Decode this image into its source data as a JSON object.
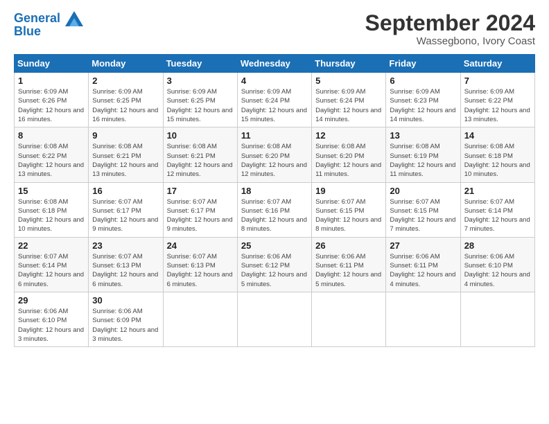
{
  "header": {
    "logo_line1": "General",
    "logo_line2": "Blue",
    "month": "September 2024",
    "location": "Wassegbono, Ivory Coast"
  },
  "weekdays": [
    "Sunday",
    "Monday",
    "Tuesday",
    "Wednesday",
    "Thursday",
    "Friday",
    "Saturday"
  ],
  "weeks": [
    [
      {
        "day": "1",
        "sunrise": "6:09 AM",
        "sunset": "6:26 PM",
        "daylight": "12 hours and 16 minutes."
      },
      {
        "day": "2",
        "sunrise": "6:09 AM",
        "sunset": "6:25 PM",
        "daylight": "12 hours and 16 minutes."
      },
      {
        "day": "3",
        "sunrise": "6:09 AM",
        "sunset": "6:25 PM",
        "daylight": "12 hours and 15 minutes."
      },
      {
        "day": "4",
        "sunrise": "6:09 AM",
        "sunset": "6:24 PM",
        "daylight": "12 hours and 15 minutes."
      },
      {
        "day": "5",
        "sunrise": "6:09 AM",
        "sunset": "6:24 PM",
        "daylight": "12 hours and 14 minutes."
      },
      {
        "day": "6",
        "sunrise": "6:09 AM",
        "sunset": "6:23 PM",
        "daylight": "12 hours and 14 minutes."
      },
      {
        "day": "7",
        "sunrise": "6:09 AM",
        "sunset": "6:22 PM",
        "daylight": "12 hours and 13 minutes."
      }
    ],
    [
      {
        "day": "8",
        "sunrise": "6:08 AM",
        "sunset": "6:22 PM",
        "daylight": "12 hours and 13 minutes."
      },
      {
        "day": "9",
        "sunrise": "6:08 AM",
        "sunset": "6:21 PM",
        "daylight": "12 hours and 13 minutes."
      },
      {
        "day": "10",
        "sunrise": "6:08 AM",
        "sunset": "6:21 PM",
        "daylight": "12 hours and 12 minutes."
      },
      {
        "day": "11",
        "sunrise": "6:08 AM",
        "sunset": "6:20 PM",
        "daylight": "12 hours and 12 minutes."
      },
      {
        "day": "12",
        "sunrise": "6:08 AM",
        "sunset": "6:20 PM",
        "daylight": "12 hours and 11 minutes."
      },
      {
        "day": "13",
        "sunrise": "6:08 AM",
        "sunset": "6:19 PM",
        "daylight": "12 hours and 11 minutes."
      },
      {
        "day": "14",
        "sunrise": "6:08 AM",
        "sunset": "6:18 PM",
        "daylight": "12 hours and 10 minutes."
      }
    ],
    [
      {
        "day": "15",
        "sunrise": "6:08 AM",
        "sunset": "6:18 PM",
        "daylight": "12 hours and 10 minutes."
      },
      {
        "day": "16",
        "sunrise": "6:07 AM",
        "sunset": "6:17 PM",
        "daylight": "12 hours and 9 minutes."
      },
      {
        "day": "17",
        "sunrise": "6:07 AM",
        "sunset": "6:17 PM",
        "daylight": "12 hours and 9 minutes."
      },
      {
        "day": "18",
        "sunrise": "6:07 AM",
        "sunset": "6:16 PM",
        "daylight": "12 hours and 8 minutes."
      },
      {
        "day": "19",
        "sunrise": "6:07 AM",
        "sunset": "6:15 PM",
        "daylight": "12 hours and 8 minutes."
      },
      {
        "day": "20",
        "sunrise": "6:07 AM",
        "sunset": "6:15 PM",
        "daylight": "12 hours and 7 minutes."
      },
      {
        "day": "21",
        "sunrise": "6:07 AM",
        "sunset": "6:14 PM",
        "daylight": "12 hours and 7 minutes."
      }
    ],
    [
      {
        "day": "22",
        "sunrise": "6:07 AM",
        "sunset": "6:14 PM",
        "daylight": "12 hours and 6 minutes."
      },
      {
        "day": "23",
        "sunrise": "6:07 AM",
        "sunset": "6:13 PM",
        "daylight": "12 hours and 6 minutes."
      },
      {
        "day": "24",
        "sunrise": "6:07 AM",
        "sunset": "6:13 PM",
        "daylight": "12 hours and 6 minutes."
      },
      {
        "day": "25",
        "sunrise": "6:06 AM",
        "sunset": "6:12 PM",
        "daylight": "12 hours and 5 minutes."
      },
      {
        "day": "26",
        "sunrise": "6:06 AM",
        "sunset": "6:11 PM",
        "daylight": "12 hours and 5 minutes."
      },
      {
        "day": "27",
        "sunrise": "6:06 AM",
        "sunset": "6:11 PM",
        "daylight": "12 hours and 4 minutes."
      },
      {
        "day": "28",
        "sunrise": "6:06 AM",
        "sunset": "6:10 PM",
        "daylight": "12 hours and 4 minutes."
      }
    ],
    [
      {
        "day": "29",
        "sunrise": "6:06 AM",
        "sunset": "6:10 PM",
        "daylight": "12 hours and 3 minutes."
      },
      {
        "day": "30",
        "sunrise": "6:06 AM",
        "sunset": "6:09 PM",
        "daylight": "12 hours and 3 minutes."
      },
      null,
      null,
      null,
      null,
      null
    ]
  ]
}
